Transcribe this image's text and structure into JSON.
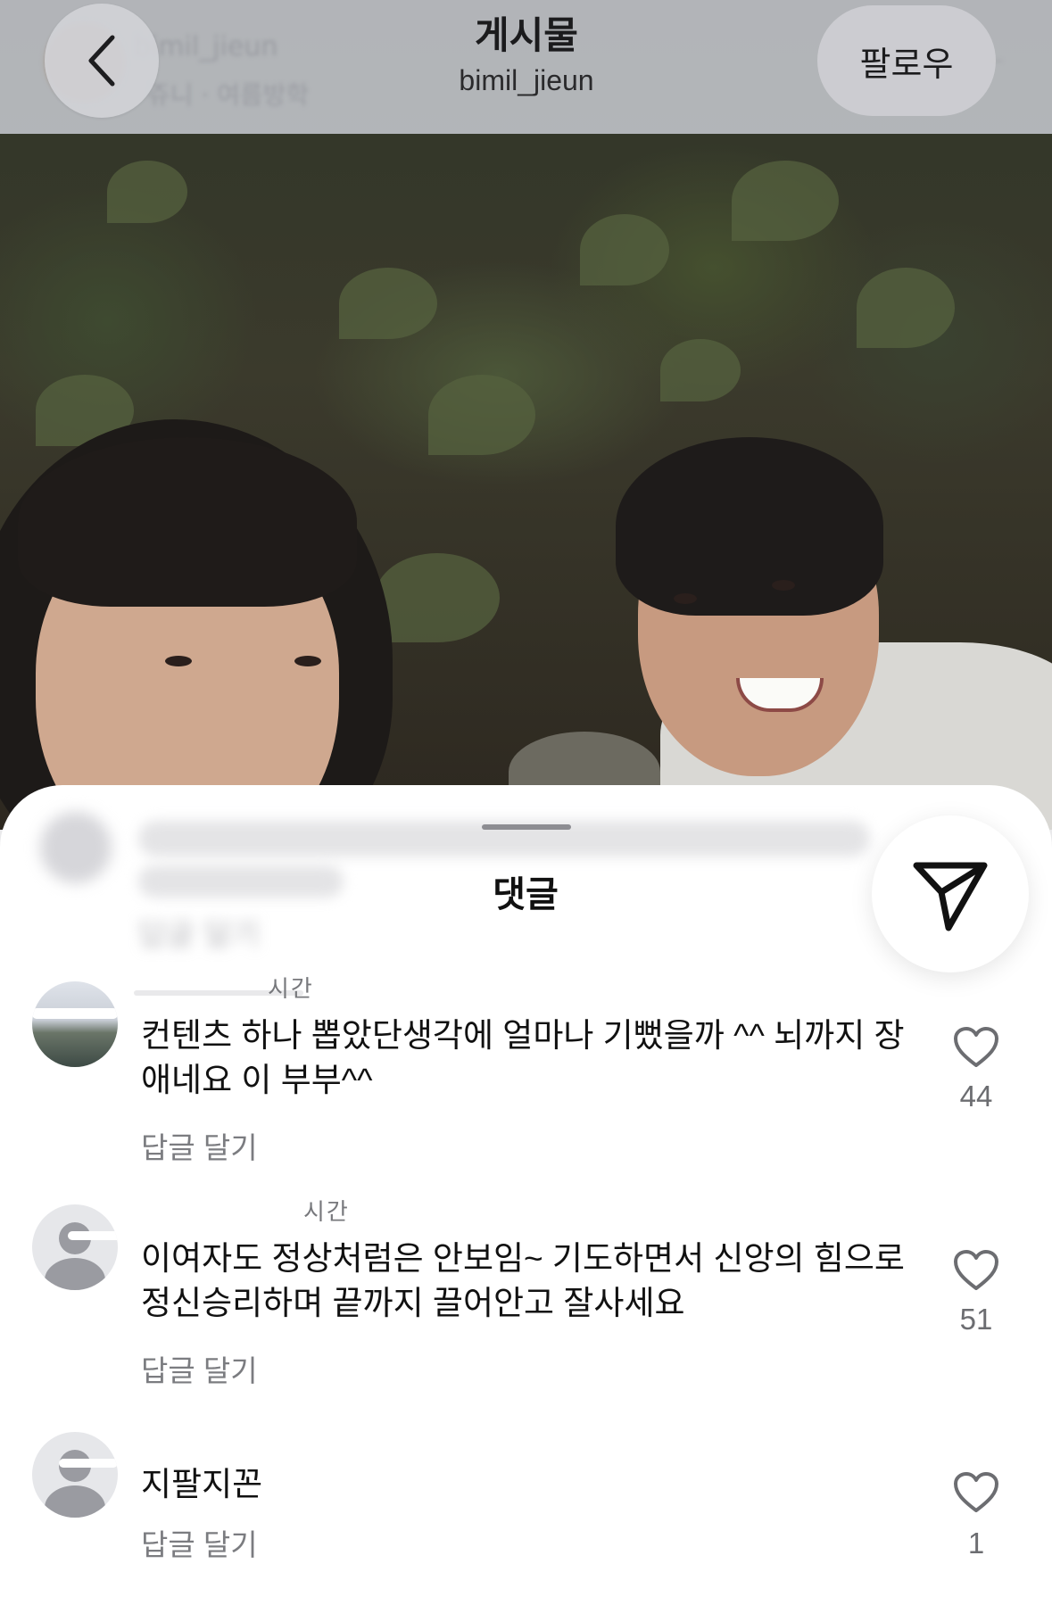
{
  "header": {
    "title": "게시물",
    "subtitle": "bimil_jieun",
    "follow_label": "팔로우",
    "behind_username": "bimil_jieun",
    "behind_song": "쥬니 · 여름방학"
  },
  "sheet": {
    "title": "댓글",
    "blurred_reply_label": "답글 달기"
  },
  "comments": [
    {
      "meta": "시간",
      "text": "컨텐츠 하나 뽑았단생각에 얼마나 기뻤을까 ^^ 뇌까지 장애네요 이 부부^^",
      "reply_label": "답글 달기",
      "likes": "44"
    },
    {
      "meta": "시간",
      "text": "이여자도 정상처럼은 안보임~ 기도하면서 신앙의 힘으로 정신승리하며 끝까지 끌어안고 잘사세요",
      "reply_label": "답글 달기",
      "likes": "51"
    },
    {
      "meta": "",
      "text": "지팔지꼰",
      "reply_label": "답글 달기",
      "likes": "1"
    }
  ],
  "icons": {
    "back": "chevron-left-icon",
    "share": "paper-plane-icon",
    "like": "heart-outline-icon"
  },
  "colors": {
    "sheet_bg": "#ffffff",
    "topbar_bg": "#bcbec4",
    "secondary_text": "#7b7c80"
  }
}
